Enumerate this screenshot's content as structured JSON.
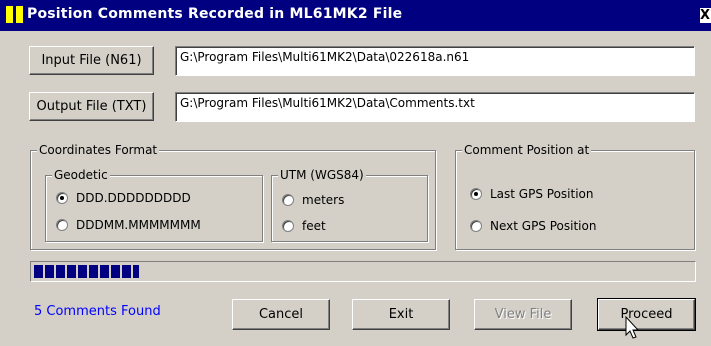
{
  "window": {
    "title": "Position Comments Recorded in ML61MK2 File",
    "close_label": "X"
  },
  "input_file": {
    "button_label": "Input File (N61)",
    "path": "G:\\Program Files\\Multi61MK2\\Data\\022618a.n61"
  },
  "output_file": {
    "button_label": "Output File (TXT)",
    "path": "G:\\Program Files\\Multi61MK2\\Data\\Comments.txt"
  },
  "coordinates": {
    "group_label": "Coordinates Format",
    "geodetic": {
      "label": "Geodetic",
      "options": [
        "DDD.DDDDDDDDD",
        "DDDMM.MMMMMMM"
      ],
      "selected": 0
    },
    "utm": {
      "label": "UTM (WGS84)",
      "options": [
        "meters",
        "feet"
      ]
    }
  },
  "comment_position": {
    "group_label": "Comment Position at",
    "options": [
      "Last GPS Position",
      "Next GPS Position"
    ],
    "selected": 0
  },
  "progress": {
    "fraction": 0.16,
    "color": "#000080"
  },
  "status": {
    "text": "5 Comments Found",
    "color": "#0000ff"
  },
  "buttons": {
    "cancel": "Cancel",
    "exit": "Exit",
    "view_file": "View File",
    "proceed": "Proceed"
  }
}
